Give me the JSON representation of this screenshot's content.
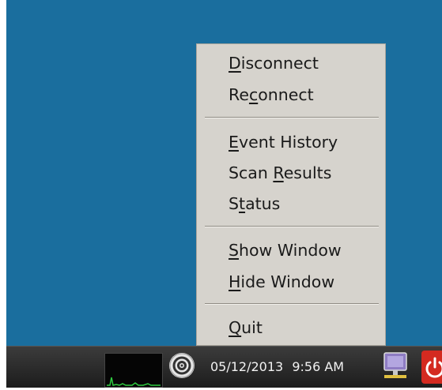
{
  "menu": {
    "items": [
      {
        "label": "Disconnect",
        "mnemonic_index": 0
      },
      {
        "label": "Reconnect",
        "mnemonic_index": 2
      },
      {
        "label": "Event History",
        "mnemonic_index": 0
      },
      {
        "label": "Scan Results",
        "mnemonic_index": 5
      },
      {
        "label": "Status",
        "mnemonic_index": 1
      },
      {
        "label": "Show Window",
        "mnemonic_index": 0
      },
      {
        "label": "Hide Window",
        "mnemonic_index": 0
      },
      {
        "label": "Quit",
        "mnemonic_index": 0
      }
    ]
  },
  "taskbar": {
    "date": "05/12/2013",
    "time": "9:56 AM",
    "icons": [
      "network-monitor-graph",
      "wifi-icon",
      "network-status-icon",
      "power-icon"
    ]
  },
  "colors": {
    "desktop": "#1a6e9e",
    "menu_bg": "#d6d3cd",
    "taskbar": "#2b2b2b",
    "power": "#d42a20"
  }
}
